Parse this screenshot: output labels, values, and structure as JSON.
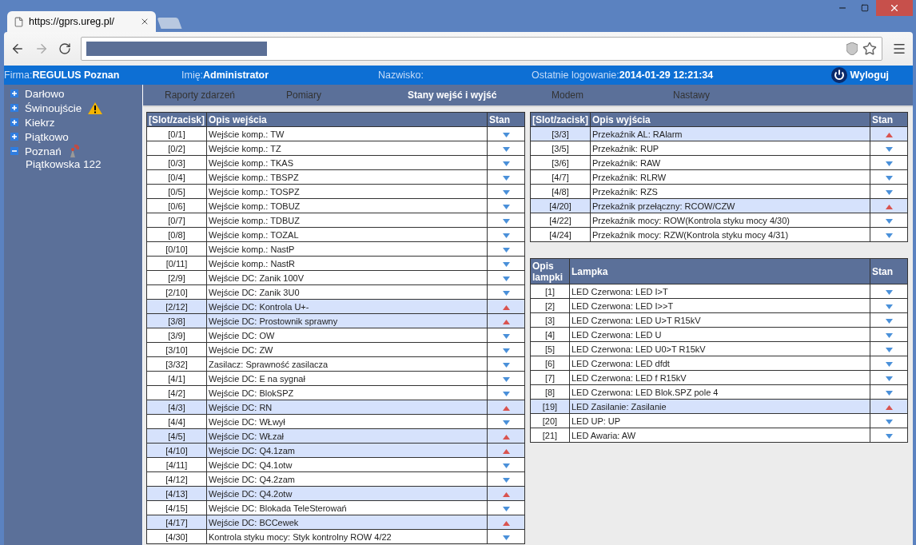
{
  "browser": {
    "tab_title": "https://gprs.ureg.pl/"
  },
  "header": {
    "fields": [
      {
        "label": "Firma:",
        "value": "REGULUS Poznan"
      },
      {
        "label": "Imię:",
        "value": "Administrator"
      },
      {
        "label": "Nazwisko:"
      },
      {
        "label": "Ostatnie logowanie:",
        "value": "2014-01-29 12:21:34"
      }
    ],
    "logout": "Wyloguj"
  },
  "sidebar": {
    "items": [
      {
        "label": "Darłowo",
        "expanded": false,
        "warning": false,
        "connected": false
      },
      {
        "label": "Świnoujście",
        "expanded": false,
        "warning": true,
        "connected": false
      },
      {
        "label": "Kiekrz",
        "expanded": false,
        "warning": false,
        "connected": false
      },
      {
        "label": "Piątkowo",
        "expanded": false,
        "warning": false,
        "connected": false
      },
      {
        "label": "Poznań",
        "expanded": true,
        "warning": false,
        "connected": true,
        "children": [
          {
            "label": "Piątkowska 122"
          }
        ]
      }
    ]
  },
  "nav": [
    {
      "label": "Raporty zdarzeń",
      "selected": false
    },
    {
      "label": "Pomiary",
      "selected": false
    },
    {
      "label": "Stany wejść i wyjść",
      "selected": true
    },
    {
      "label": "Modem",
      "selected": false
    },
    {
      "label": "Nastawy",
      "selected": false
    }
  ],
  "inputs": {
    "columns": [
      "[Slot/zacisk]",
      "Opis wejścia",
      "Stan"
    ],
    "rows": [
      {
        "slot": "[0/1]",
        "text": "Wejście komp.: TW",
        "active": false
      },
      {
        "slot": "[0/2]",
        "text": "Wejście komp.: TZ",
        "active": false
      },
      {
        "slot": "[0/3]",
        "text": "Wejście komp.: TKAS",
        "active": false
      },
      {
        "slot": "[0/4]",
        "text": "Wejście komp.: TBSPZ",
        "active": false
      },
      {
        "slot": "[0/5]",
        "text": "Wejście komp.: TOSPZ",
        "active": false
      },
      {
        "slot": "[0/6]",
        "text": "Wejście komp.: TOBUZ",
        "active": false
      },
      {
        "slot": "[0/7]",
        "text": "Wejście komp.: TDBUZ",
        "active": false
      },
      {
        "slot": "[0/8]",
        "text": "Wejście komp.: TOZAL",
        "active": false
      },
      {
        "slot": "[0/10]",
        "text": "Wejście komp.: NastP",
        "active": false
      },
      {
        "slot": "[0/11]",
        "text": "Wejście komp.: NastR",
        "active": false
      },
      {
        "slot": "[2/9]",
        "text": "Wejście DC: Zanik 100V",
        "active": false
      },
      {
        "slot": "[2/10]",
        "text": "Wejście DC: Zanik 3U0",
        "active": false
      },
      {
        "slot": "[2/12]",
        "text": "Wejście DC: Kontrola U+-",
        "active": true
      },
      {
        "slot": "[3/8]",
        "text": "Wejście DC: Prostownik sprawny",
        "active": true
      },
      {
        "slot": "[3/9]",
        "text": "Wejście DC: OW",
        "active": false
      },
      {
        "slot": "[3/10]",
        "text": "Wejście DC: ZW",
        "active": false
      },
      {
        "slot": "[3/32]",
        "text": "Zasilacz: Sprawność zasilacza",
        "active": false
      },
      {
        "slot": "[4/1]",
        "text": "Wejście DC: E na sygnał",
        "active": false
      },
      {
        "slot": "[4/2]",
        "text": "Wejście DC: BlokSPZ",
        "active": false
      },
      {
        "slot": "[4/3]",
        "text": "Wejście DC: RN",
        "active": true
      },
      {
        "slot": "[4/4]",
        "text": "Wejście DC: WŁwył",
        "active": false
      },
      {
        "slot": "[4/5]",
        "text": "Wejście DC: WŁzał",
        "active": true
      },
      {
        "slot": "[4/10]",
        "text": "Wejście DC: Q4.1zam",
        "active": true
      },
      {
        "slot": "[4/11]",
        "text": "Wejście DC: Q4.1otw",
        "active": false
      },
      {
        "slot": "[4/12]",
        "text": "Wejście DC: Q4.2zam",
        "active": false
      },
      {
        "slot": "[4/13]",
        "text": "Wejście DC: Q4.2otw",
        "active": true
      },
      {
        "slot": "[4/15]",
        "text": "Wejście DC: Blokada TeleSterowań",
        "active": false
      },
      {
        "slot": "[4/17]",
        "text": "Wejście DC: BCCewek",
        "active": true
      },
      {
        "slot": "[4/30]",
        "text": "Kontrola styku mocy: Styk kontrolny ROW 4/22",
        "active": false
      }
    ]
  },
  "outputs": {
    "columns": [
      "[Slot/zacisk]",
      "Opis wyjścia",
      "Stan"
    ],
    "rows": [
      {
        "slot": "[3/3]",
        "text": "Przekaźnik AL: RAlarm",
        "active": true
      },
      {
        "slot": "[3/5]",
        "text": "Przekaźnik: RUP",
        "active": false
      },
      {
        "slot": "[3/6]",
        "text": "Przekaźnik: RAW",
        "active": false
      },
      {
        "slot": "[4/7]",
        "text": "Przekaźnik: RLRW",
        "active": false
      },
      {
        "slot": "[4/8]",
        "text": "Przekaźnik: RZS",
        "active": false
      },
      {
        "slot": "[4/20]",
        "text": "Przekaźnik przełączny: RCOW/CZW",
        "active": true
      },
      {
        "slot": "[4/22]",
        "text": "Przekaźnik mocy: ROW(Kontrola styku mocy 4/30)",
        "active": false
      },
      {
        "slot": "[4/24]",
        "text": "Przekaźnik mocy: RZW(Kontrola styku mocy 4/31)",
        "active": false
      }
    ]
  },
  "lamps": {
    "columns": [
      "Opis lampki",
      "Lampka",
      "Stan"
    ],
    "rows": [
      {
        "slot": "[1]",
        "text": "LED Czerwona: LED I>T",
        "active": false
      },
      {
        "slot": "[2]",
        "text": "LED Czerwona: LED I>>T",
        "active": false
      },
      {
        "slot": "[3]",
        "text": "LED Czerwona: LED U>T R15kV",
        "active": false
      },
      {
        "slot": "[4]",
        "text": "LED Czerwona: LED U",
        "active": false
      },
      {
        "slot": "[5]",
        "text": "LED Czerwona: LED U0>T R15kV",
        "active": false
      },
      {
        "slot": "[6]",
        "text": "LED Czerwona: LED dfdt",
        "active": false
      },
      {
        "slot": "[7]",
        "text": "LED Czerwona: LED f R15kV",
        "active": false
      },
      {
        "slot": "[8]",
        "text": "LED Czerwona: LED Blok.SPZ pole 4",
        "active": false
      },
      {
        "slot": "[19]",
        "text": "LED Zasilanie: Zasilanie",
        "active": true
      },
      {
        "slot": "[20]",
        "text": "LED UP: UP",
        "active": false
      },
      {
        "slot": "[21]",
        "text": "LED Awaria: AW",
        "active": false
      }
    ]
  }
}
